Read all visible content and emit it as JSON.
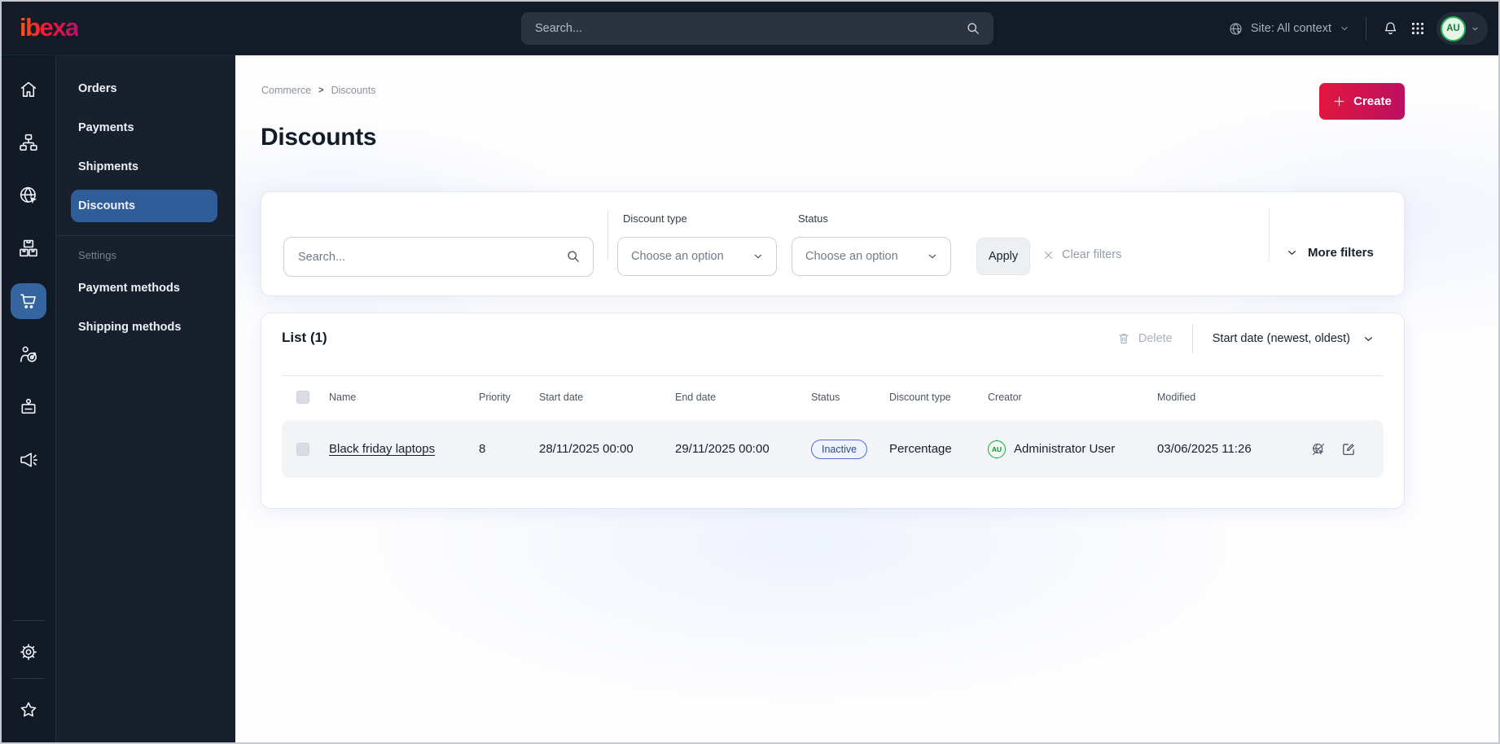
{
  "brand": {
    "logo_text": "ibexa"
  },
  "topbar": {
    "search_placeholder": "Search...",
    "site_selector_label": "Site: All context",
    "user_initials": "AU"
  },
  "rail": {
    "items": [
      "home",
      "content-tree",
      "site",
      "products",
      "commerce",
      "customers",
      "users",
      "marketing"
    ],
    "active_item": "commerce",
    "bottom_items": [
      "settings",
      "bookmarks"
    ]
  },
  "sidebar": {
    "items": [
      {
        "label": "Orders",
        "active": false
      },
      {
        "label": "Payments",
        "active": false
      },
      {
        "label": "Shipments",
        "active": false
      },
      {
        "label": "Discounts",
        "active": true
      }
    ],
    "section_label": "Settings",
    "settings_items": [
      {
        "label": "Payment methods"
      },
      {
        "label": "Shipping methods"
      }
    ]
  },
  "breadcrumb": {
    "items": [
      "Commerce",
      "Discounts"
    ],
    "separator": ">"
  },
  "page": {
    "title": "Discounts",
    "create_label": "Create"
  },
  "filters": {
    "search_placeholder": "Search...",
    "discount_type_label": "Discount type",
    "discount_type_value": "Choose an option",
    "status_label": "Status",
    "status_value": "Choose an option",
    "apply_label": "Apply",
    "clear_label": "Clear filters",
    "more_label": "More filters"
  },
  "list": {
    "title": "List (1)",
    "delete_label": "Delete",
    "sort_label": "Start date (newest, oldest)",
    "columns": [
      "Name",
      "Priority",
      "Start date",
      "End date",
      "Status",
      "Discount type",
      "Creator",
      "Modified"
    ],
    "rows": [
      {
        "name": "Black friday laptops",
        "priority": "8",
        "start_date": "28/11/2025 00:00",
        "end_date": "29/11/2025 00:00",
        "status": "Inactive",
        "discount_type": "Percentage",
        "creator": "Administrator User",
        "creator_initials": "AU",
        "modified": "03/06/2025 11:26"
      }
    ]
  },
  "colors": {
    "topbar_bg": "#131b27",
    "sidebar_bg": "#18202d",
    "active_nav_blue": "#2f5d99",
    "create_gradient_start": "#e2173d",
    "create_gradient_end": "#bb0f62",
    "status_inactive_border": "#4f6fbe",
    "status_inactive_text": "#2c4a8c",
    "avatar_green": "#15a845"
  }
}
